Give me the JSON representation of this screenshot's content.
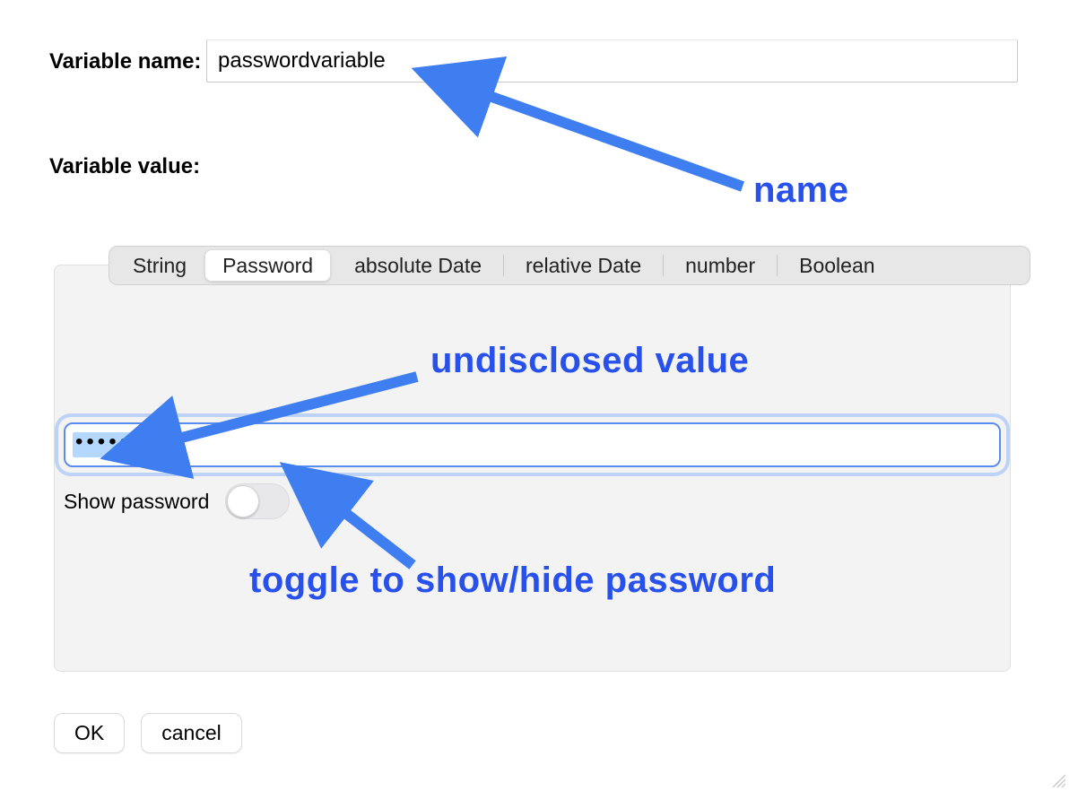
{
  "labels": {
    "variable_name": "Variable name:",
    "variable_value": "Variable value:",
    "show_password": "Show password"
  },
  "inputs": {
    "variable_name_value": "passwordvariable",
    "password_masked": "•••••"
  },
  "tabs": [
    "String",
    "Password",
    "absolute Date",
    "relative Date",
    "number",
    "Boolean"
  ],
  "active_tab_index": 1,
  "toggles": {
    "show_password_on": false
  },
  "buttons": {
    "ok": "OK",
    "cancel": "cancel"
  },
  "annotations": {
    "name": "name",
    "value": "undisclosed value",
    "toggle": "toggle to show/hide password"
  },
  "colors": {
    "annotation": "#2850eb",
    "arrow": "#3f7ef0",
    "focus_ring": "#5b8def"
  }
}
